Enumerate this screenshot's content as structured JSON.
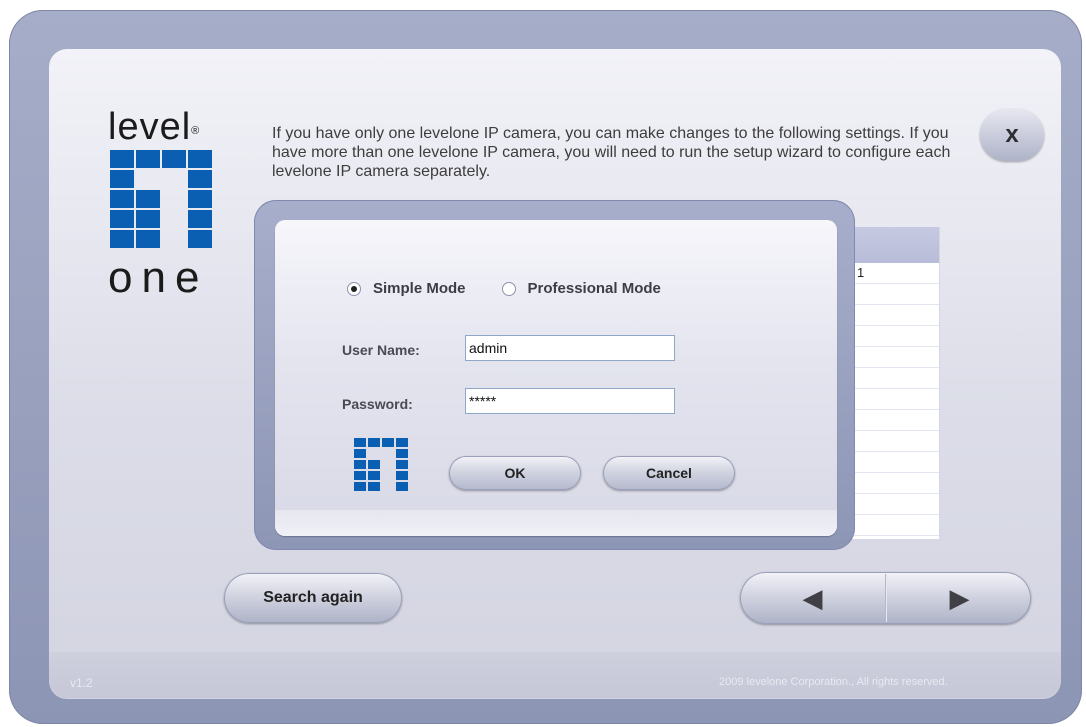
{
  "logo": {
    "top_text": "level",
    "registered_mark": "®",
    "bottom_text": "one"
  },
  "info": {
    "text": "If you have only one levelone IP camera, you can make changes to the following settings. If you have more than one levelone IP camera, you will need to run the setup wizard to configure each levelone IP camera separately."
  },
  "close_button": {
    "label": "x"
  },
  "camera_list": {
    "rows": [
      "1",
      "",
      "",
      "",
      "",
      "",
      "",
      "",
      "",
      "",
      "",
      "",
      "",
      ""
    ]
  },
  "login_dialog": {
    "modes": [
      {
        "label": "Simple Mode",
        "selected": true
      },
      {
        "label": "Professional Mode",
        "selected": false
      }
    ],
    "username_label": "User Name:",
    "username_value": "admin",
    "password_label": "Password:",
    "password_value": "*****",
    "ok_label": "OK",
    "cancel_label": "Cancel"
  },
  "buttons": {
    "search_again": "Search again",
    "back_icon": "◀",
    "next_icon": "▶"
  },
  "footer": {
    "version": "v1.2",
    "copyright": "2009 levelone Corporation., All rights reserved."
  },
  "colors": {
    "brand_blue": "#0b5fb3",
    "frame": "#9ba2c0",
    "panel": "#e3e4ee"
  }
}
